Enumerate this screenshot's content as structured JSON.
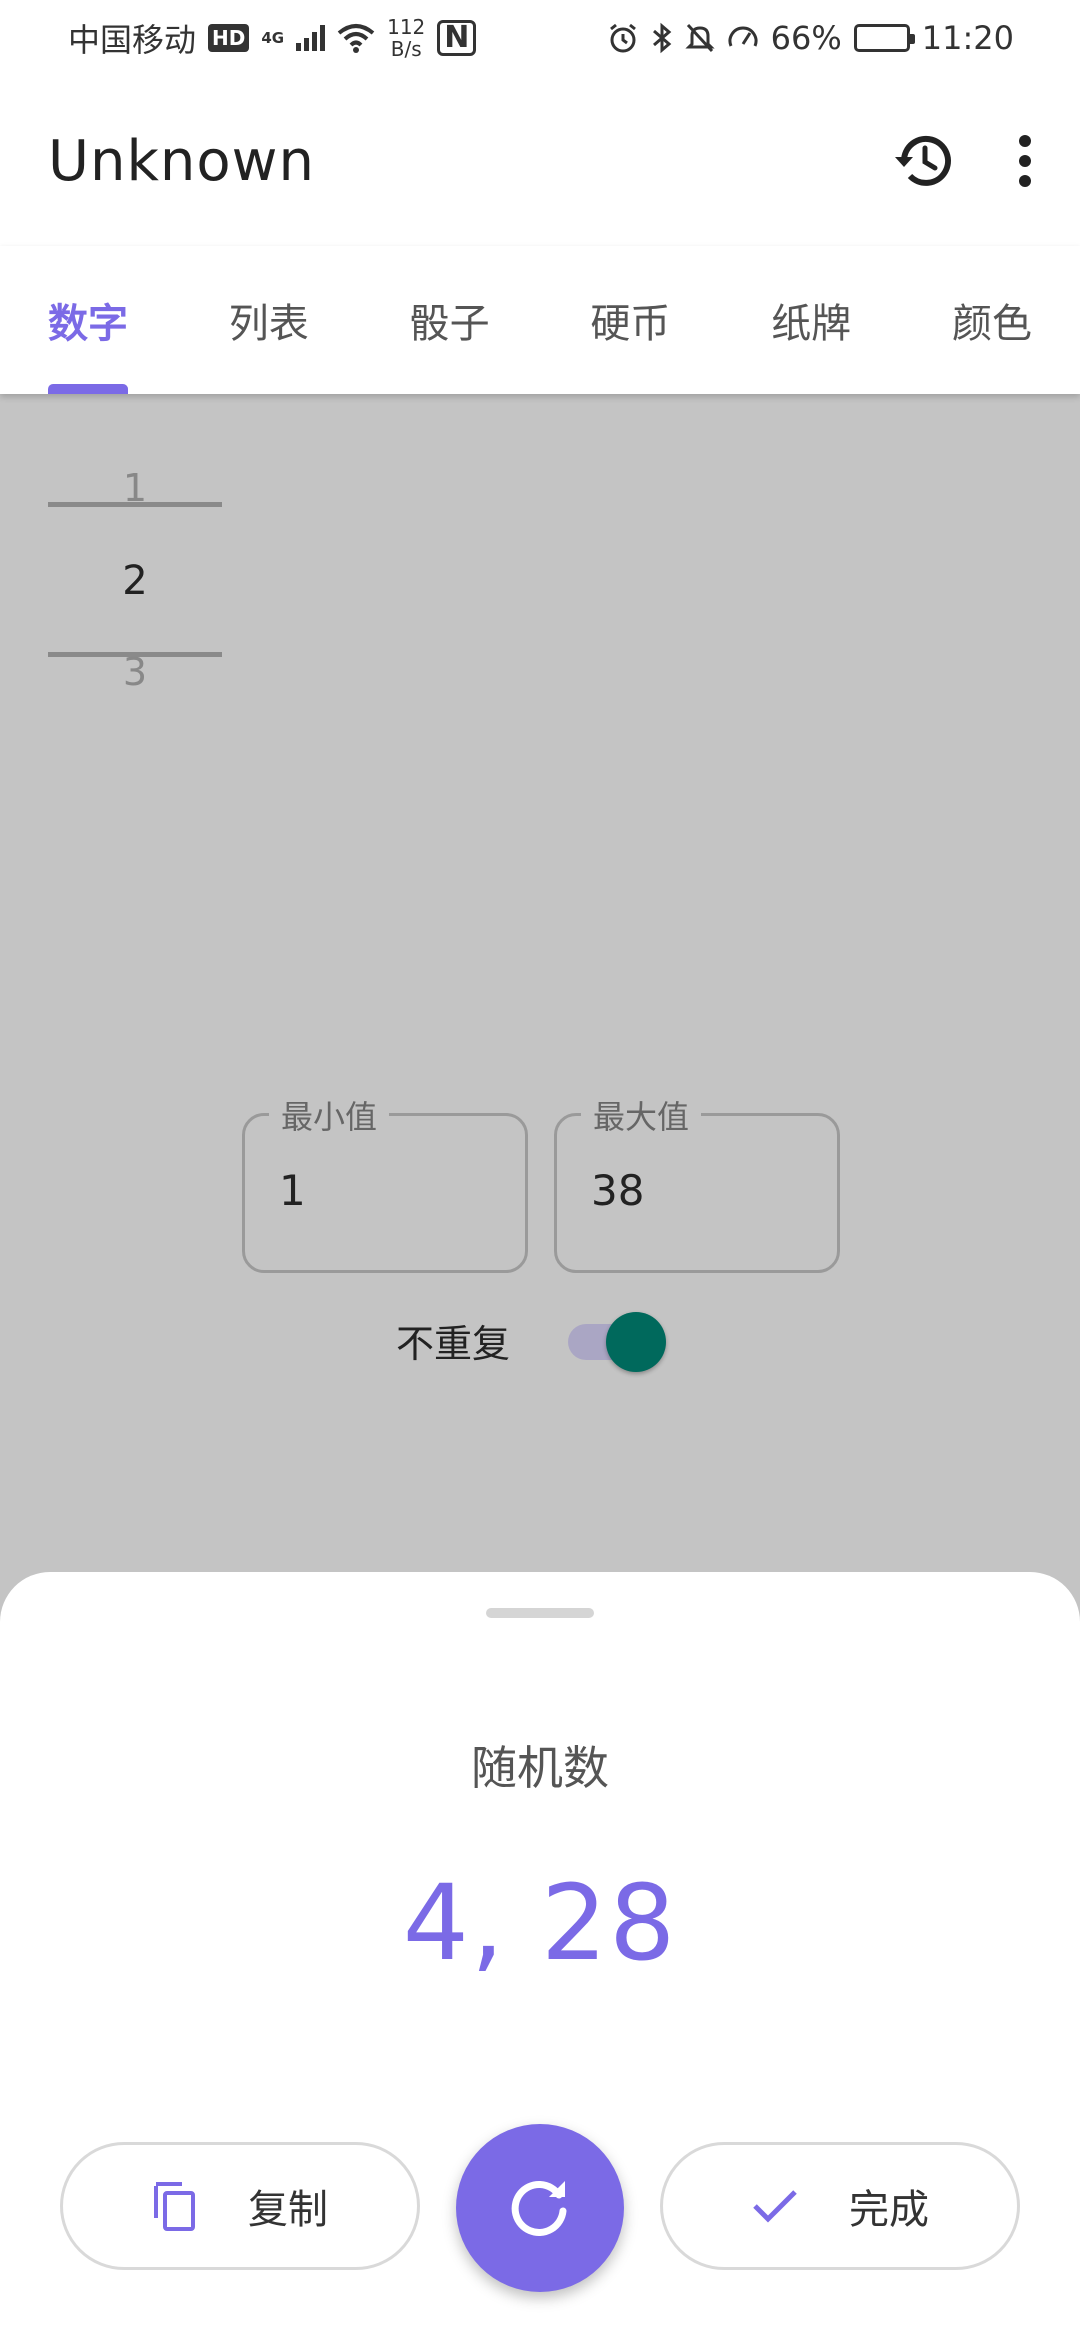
{
  "status_bar": {
    "carrier": "中国移动",
    "hd": "HD",
    "network": "4G",
    "speed_value": "112",
    "speed_unit": "B/s",
    "nfc": "N",
    "battery": "66%",
    "battery_level": 0.66,
    "time": "11:20"
  },
  "app_bar": {
    "title": "Unknown",
    "icons": [
      "history-icon",
      "more-vert-icon"
    ]
  },
  "tabs": [
    {
      "label": "数字",
      "active": true
    },
    {
      "label": "列表",
      "active": false
    },
    {
      "label": "骰子",
      "active": false
    },
    {
      "label": "硬币",
      "active": false
    },
    {
      "label": "纸牌",
      "active": false
    },
    {
      "label": "颜色",
      "active": false
    }
  ],
  "picker": {
    "prev": "1",
    "current": "2",
    "next": "3"
  },
  "range": {
    "min_label": "最小值",
    "min_value": "1",
    "max_label": "最大值",
    "max_value": "38"
  },
  "no_repeat": {
    "label": "不重复",
    "on": true
  },
  "sheet": {
    "title": "随机数",
    "result": "4, 28",
    "copy_label": "复制",
    "done_label": "完成"
  },
  "colors": {
    "accent": "#7b6ae6",
    "switch_thumb": "#00695c",
    "scrim": "#c4c4c4"
  }
}
